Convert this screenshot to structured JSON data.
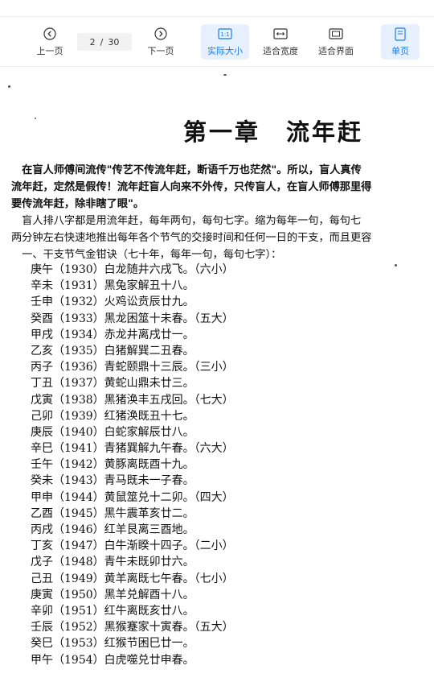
{
  "toolbar": {
    "prev_label": "上一页",
    "next_label": "下一页",
    "page_current": "2",
    "page_separator": "/",
    "page_total": "30",
    "actual_size_label": "实际大小",
    "actual_size_icon_text": "1:1",
    "fit_width_label": "适合宽度",
    "fit_page_label": "适合界面",
    "single_page_label": "单页"
  },
  "document": {
    "chapter_title": "第一章　流年赶",
    "paragraphs": [
      "　在盲人师傅间流传\"传艺不传流年赶，断语千万也茫然\"。所以，盲人真传",
      "流年赶，定然是假传！流年赶盲人向来不外传，只传盲人，在盲人师傅那里得",
      "要传流年赶，除非瞎了眼\"。",
      "　盲人排八字都是用流年赶，每年两句，每句七字。缩为每年一句，每句七",
      "两分钟左右快速地推出每年各个节气的交接时间和任何一日的干支，而且更容",
      "　一、干支节气金钳诀（七十年，每年一句，每句七字）："
    ],
    "items": [
      "庚午（1930）白龙随井六戌飞。（六小）",
      "辛未（1931）黑兔家解丑十八。",
      "壬申（1932）火鸡讼贲辰廿九。",
      "癸酉（1933）黑龙困筮十未春。（五大）",
      "甲戌（1934）赤龙井离戌廿一。",
      "乙亥（1935）白猪解巽二丑春。",
      "丙子（1936）青蛇颐鼎十三辰。（三小）",
      "丁丑（1937）黄蛇山鼎未廿三。",
      "戊寅（1938）黑猪涣丰五戌回。（七大）",
      "己卯（1939）红猪涣既丑十七。",
      "庚辰（1940）白蛇家解辰廿八。",
      "辛巳（1941）青猪巽解九午春。（六大）",
      "壬午（1942）黄豚离既酉十九。",
      "癸未（1943）青马既未一子春。",
      "甲申（1944）黄鼠筮兑十二卯。（四大）",
      "乙酉（1945）黑牛震革亥廿二。",
      "丙戌（1946）红羊艮离三酉地。",
      "丁亥（1947）白牛渐睽十四子。（二小）",
      "戊子（1948）青牛未既卯廿六。",
      "己丑（1949）黄羊离既七午春。（七小）",
      "庚寅（1950）黑羊兑解酉十八。",
      "辛卯（1951）红牛离既亥廿八。",
      "壬辰（1952）黑猴蹇家十寅春。（五大）",
      "癸巳（1953）红猴节困巳廿一。",
      "甲午（1954）白虎噬兑廿申春。"
    ]
  },
  "colors": {
    "accent": "#1a7be0",
    "active_bg": "#e6f1fd",
    "text": "#111111"
  }
}
